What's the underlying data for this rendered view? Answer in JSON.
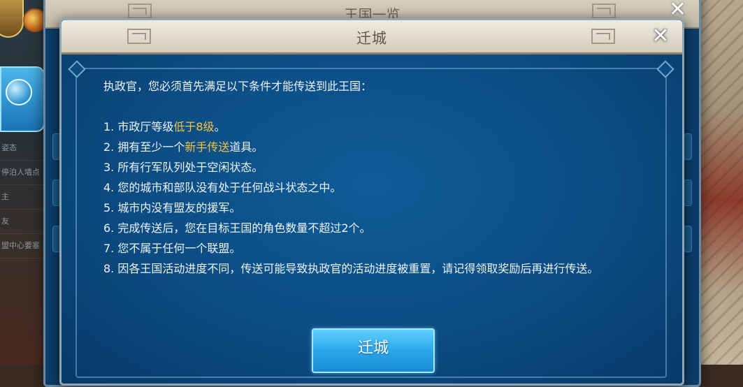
{
  "background": {
    "sidebar_items": [
      "姿态",
      "停泊人墙点",
      "主",
      "友",
      "盟中心要塞"
    ]
  },
  "back_panel": {
    "title": "王国一览",
    "close_glyph": "✕"
  },
  "dialog": {
    "title": "迁城",
    "close_glyph": "✕",
    "intro": "执政官，您必须首先满足以下条件才能传送到此王国：",
    "conditions": [
      {
        "pre": "1. 市政厅等级",
        "hl": "低于8级",
        "post": "。"
      },
      {
        "pre": "2. 拥有至少一个",
        "hl": "新手传送",
        "post": "道具。"
      },
      {
        "pre": "3. 所有行军队列处于空闲状态。",
        "hl": "",
        "post": ""
      },
      {
        "pre": "4. 您的城市和部队没有处于任何战斗状态之中。",
        "hl": "",
        "post": ""
      },
      {
        "pre": "5. 城市内没有盟友的援军。",
        "hl": "",
        "post": ""
      },
      {
        "pre": "6. 完成传送后，您在目标王国的角色数量不超过2个。",
        "hl": "",
        "post": ""
      },
      {
        "pre": "7. 您不属于任何一个联盟。",
        "hl": "",
        "post": ""
      },
      {
        "pre": "8. 因各王国活动进度不同，传送可能导致执政官的活动进度被重置，请记得领取奖励后再进行传送。",
        "hl": "",
        "post": ""
      }
    ],
    "confirm_button": "迁城"
  },
  "colors": {
    "highlight": "#f4c542",
    "dialog_bg": "#0b4c82",
    "button": "#2aa7ea"
  }
}
